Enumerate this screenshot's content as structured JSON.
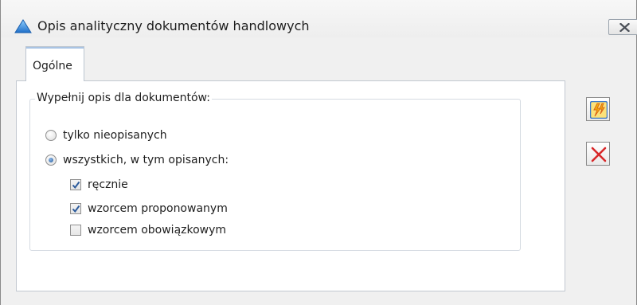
{
  "window": {
    "title": "Opis analityczny dokumentów handlowych",
    "app_icon": "blue-triangle-icon",
    "close_icon": "close-icon"
  },
  "tabs": [
    {
      "label": "Ogólne",
      "active": true
    }
  ],
  "group": {
    "legend": "Wypełnij opis dla dokumentów:",
    "radios": [
      {
        "label": "tylko nieopisanych",
        "selected": false
      },
      {
        "label": "wszystkich, w tym opisanych:",
        "selected": true
      }
    ],
    "checkboxes": [
      {
        "label": "ręcznie",
        "checked": true
      },
      {
        "label": "wzorcem proponowanym",
        "checked": true
      },
      {
        "label": "wzorcem obowiązkowym",
        "checked": false
      }
    ]
  },
  "side_buttons": [
    {
      "icon": "lightning-run-icon"
    },
    {
      "icon": "cancel-x-icon"
    }
  ],
  "colors": {
    "accent": "#3b78c8",
    "cancel_red": "#d8282a",
    "run_yellow": "#f2b705"
  }
}
